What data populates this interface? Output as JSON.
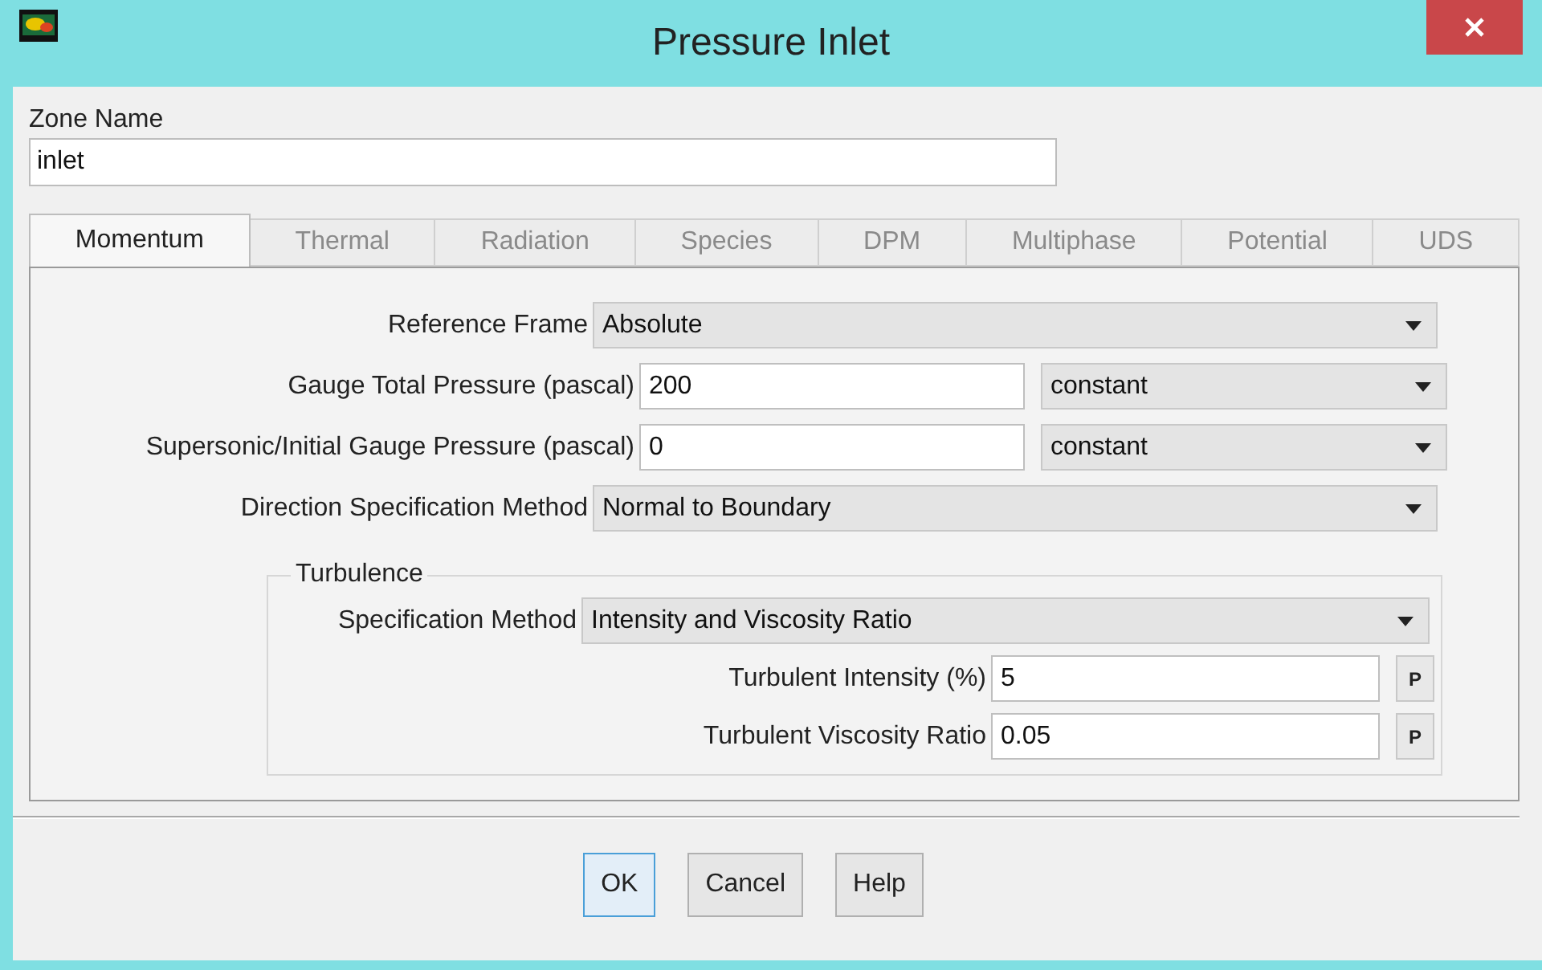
{
  "window": {
    "title": "Pressure Inlet"
  },
  "zone_name": {
    "label": "Zone Name",
    "value": "inlet"
  },
  "tabs": [
    {
      "label": "Momentum",
      "selected": true
    },
    {
      "label": "Thermal",
      "selected": false
    },
    {
      "label": "Radiation",
      "selected": false
    },
    {
      "label": "Species",
      "selected": false
    },
    {
      "label": "DPM",
      "selected": false
    },
    {
      "label": "Multiphase",
      "selected": false
    },
    {
      "label": "Potential",
      "selected": false
    },
    {
      "label": "UDS",
      "selected": false
    }
  ],
  "fields": [
    {
      "kind": "dropdown",
      "label": "Reference Frame",
      "value": "Absolute"
    },
    {
      "kind": "value_method",
      "label": "Gauge Total Pressure (pascal)",
      "value": "200",
      "method": "constant"
    },
    {
      "kind": "value_method",
      "label": "Supersonic/Initial Gauge Pressure (pascal)",
      "value": "0",
      "method": "constant"
    },
    {
      "kind": "dropdown",
      "label": "Direction Specification Method",
      "value": "Normal to Boundary"
    }
  ],
  "turbulence": {
    "title": "Turbulence",
    "fields": [
      {
        "kind": "dropdown",
        "label": "Specification Method",
        "value": "Intensity and Viscosity Ratio"
      },
      {
        "kind": "parameter",
        "label": "Turbulent Intensity (%)",
        "value": "5",
        "button": "P"
      },
      {
        "kind": "parameter",
        "label": "Turbulent Viscosity Ratio",
        "value": "0.05",
        "button": "P"
      }
    ]
  },
  "buttons": [
    {
      "label": "OK",
      "default": true
    },
    {
      "label": "Cancel",
      "default": false
    },
    {
      "label": "Help",
      "default": false
    }
  ]
}
